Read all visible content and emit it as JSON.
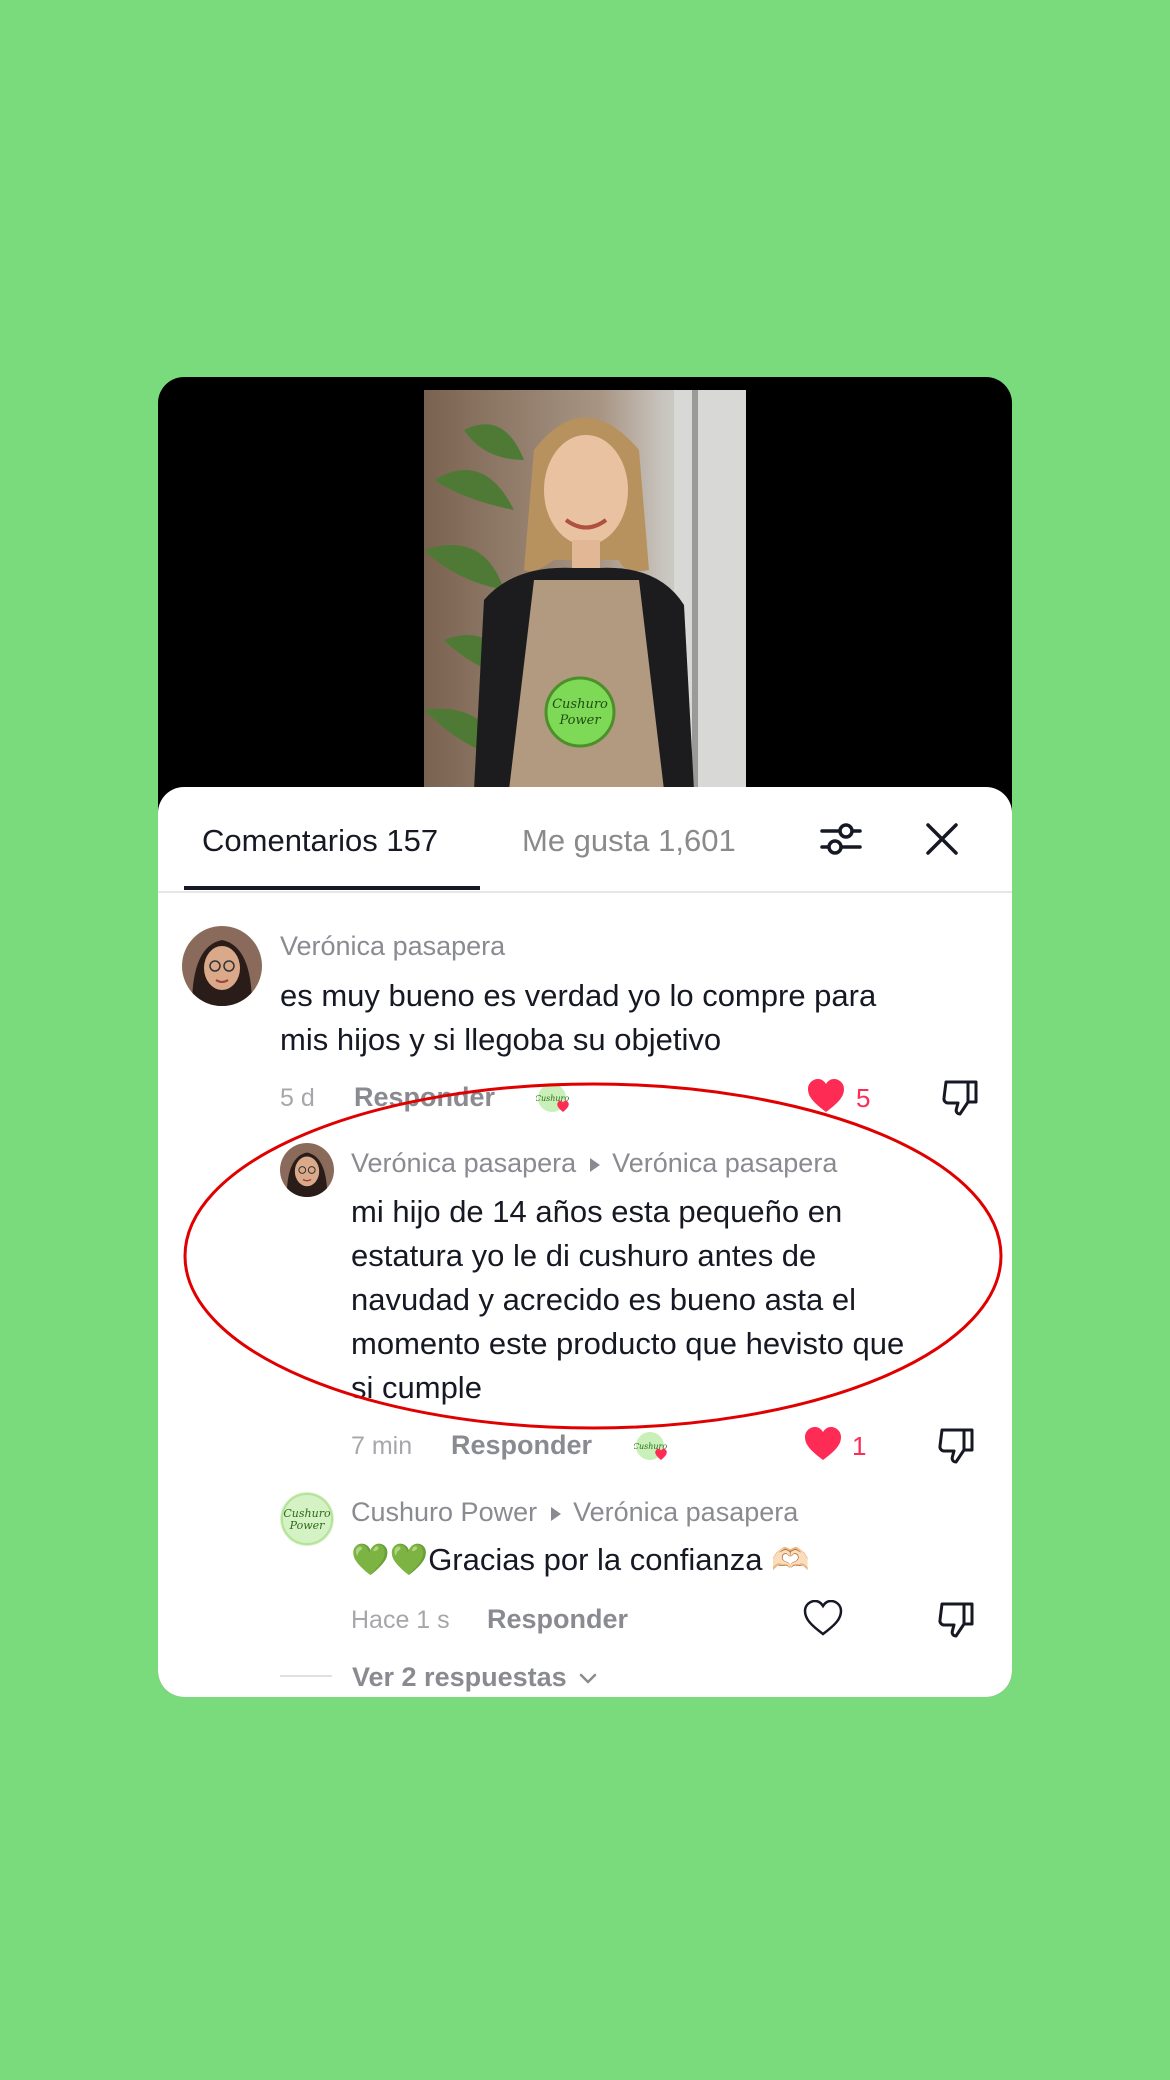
{
  "tabs": {
    "comments_label": "Comentarios 157",
    "likes_label": "Me gusta 1,601"
  },
  "comments": [
    {
      "author": "Verónica pasapera",
      "text_line1": "es muy bueno es verdad yo lo compre para",
      "text_line2": "mis hijos y si llegoba su objetivo",
      "time": "5 d",
      "reply_label": "Responder",
      "likes": "5",
      "liked": true
    },
    {
      "author": "Verónica pasapera",
      "reply_to": "Verónica pasapera",
      "text_lines": [
        "mi hijo de 14 años esta pequeño en",
        "estatura yo le di cushuro antes de",
        "navudad y acrecido es bueno asta el",
        "momento este producto que hevisto que",
        "si cumple"
      ],
      "time": "7 min",
      "reply_label": "Responder",
      "likes": "1",
      "liked": true
    },
    {
      "author": "Cushuro Power",
      "reply_to": "Verónica pasapera",
      "text": "💚💚Gracias por la confianza 🫶🏻",
      "time": "Hace 1 s",
      "reply_label": "Responder",
      "liked": false
    }
  ],
  "view_replies_label": "Ver 2 respuestas",
  "video_badge_text": "Cushuro Power",
  "colors": {
    "background": "#7adb7c",
    "like_red": "#fe2c55",
    "highlight_ring": "#e00000",
    "brand_green": "#7ed957"
  },
  "icons": [
    "filter-icon",
    "close-icon",
    "heart-icon",
    "dislike-icon",
    "chevron-down-icon",
    "creator-like-badge-icon"
  ]
}
